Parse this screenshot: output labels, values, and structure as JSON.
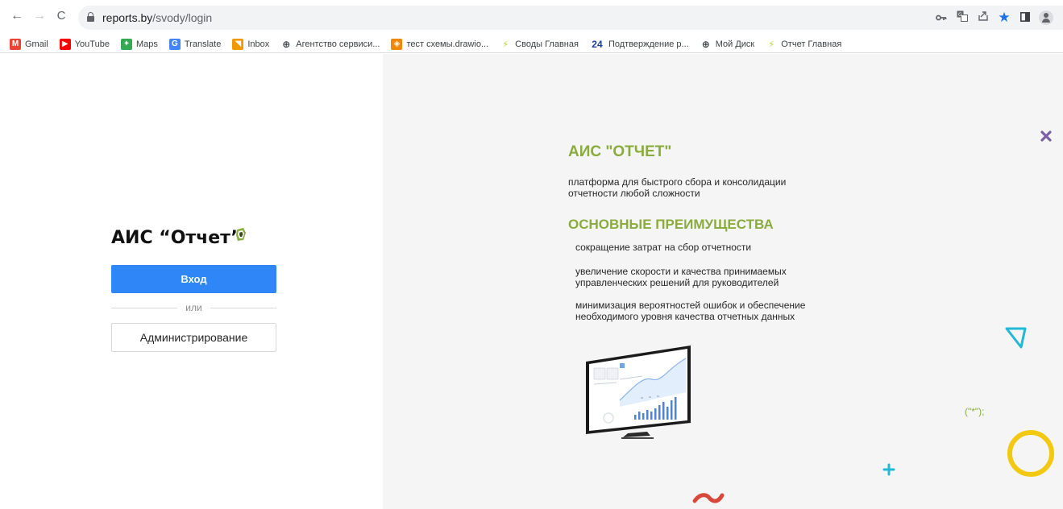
{
  "browser": {
    "url_host": "reports.by",
    "url_path": "/svody/login",
    "nav": {
      "back": "←",
      "forward": "→",
      "reload": "C"
    },
    "omnibox_icons": [
      "key-icon",
      "translate-icon",
      "share-icon",
      "star-icon",
      "side-panel-icon",
      "profile-icon"
    ],
    "bookmarks": [
      {
        "label": "Gmail",
        "icon": "gmail-icon",
        "color": "#ea4335",
        "glyph": "M"
      },
      {
        "label": "YouTube",
        "icon": "youtube-icon",
        "color": "#ff0000",
        "glyph": "▶"
      },
      {
        "label": "Maps",
        "icon": "maps-icon",
        "color": "#34a853",
        "glyph": "✦"
      },
      {
        "label": "Translate",
        "icon": "translate-icon",
        "color": "#4285f4",
        "glyph": "G"
      },
      {
        "label": "Inbox",
        "icon": "inbox-icon",
        "color": "#f29900",
        "glyph": "◥"
      },
      {
        "label": "Агентство сервиси...",
        "icon": "globe-arrow-icon",
        "color": "#3c4043",
        "glyph": "⊕"
      },
      {
        "label": "тест схемы.drawio...",
        "icon": "drawio-icon",
        "color": "#f08705",
        "glyph": "◈"
      },
      {
        "label": "Своды Главная",
        "icon": "spark-icon",
        "color": "#c4d84a",
        "glyph": "⚡"
      },
      {
        "label": "Подтверждение р...",
        "icon": "number-24-icon",
        "color": "#1a3fa0",
        "glyph": "24"
      },
      {
        "label": "Мой Диск",
        "icon": "globe-arrow-icon",
        "color": "#3c4043",
        "glyph": "⊕"
      },
      {
        "label": "Отчет Главная",
        "icon": "spark-icon",
        "color": "#c4d84a",
        "glyph": "⚡"
      }
    ]
  },
  "login": {
    "title": "АИС “Отчет”",
    "login_button": "Вход",
    "or_text": "или",
    "admin_button": "Администрирование"
  },
  "promo": {
    "title": "АИС \"ОТЧЕТ\"",
    "description": "платформа для быстрого сбора и консолидации отчетности любой сложности",
    "advantages_title": "ОСНОВНЫЕ ПРЕИМУЩЕСТВА",
    "advantages": [
      "сокращение затрат на сбор отчетности",
      "увеличение скорости и качества принимаемых управленческих решений для руководителей",
      "минимизация вероятностей ошибок и обеспечение необходимого уровня качества отчетных данных"
    ],
    "deco_code_text": "(\"*\");"
  },
  "colors": {
    "primary": "#2f86f6",
    "accent_green": "#8aac3c",
    "deco_purple": "#7b5ea7",
    "deco_cyan": "#22b8d6",
    "deco_yellow": "#f2c811",
    "deco_red": "#d9473b"
  }
}
